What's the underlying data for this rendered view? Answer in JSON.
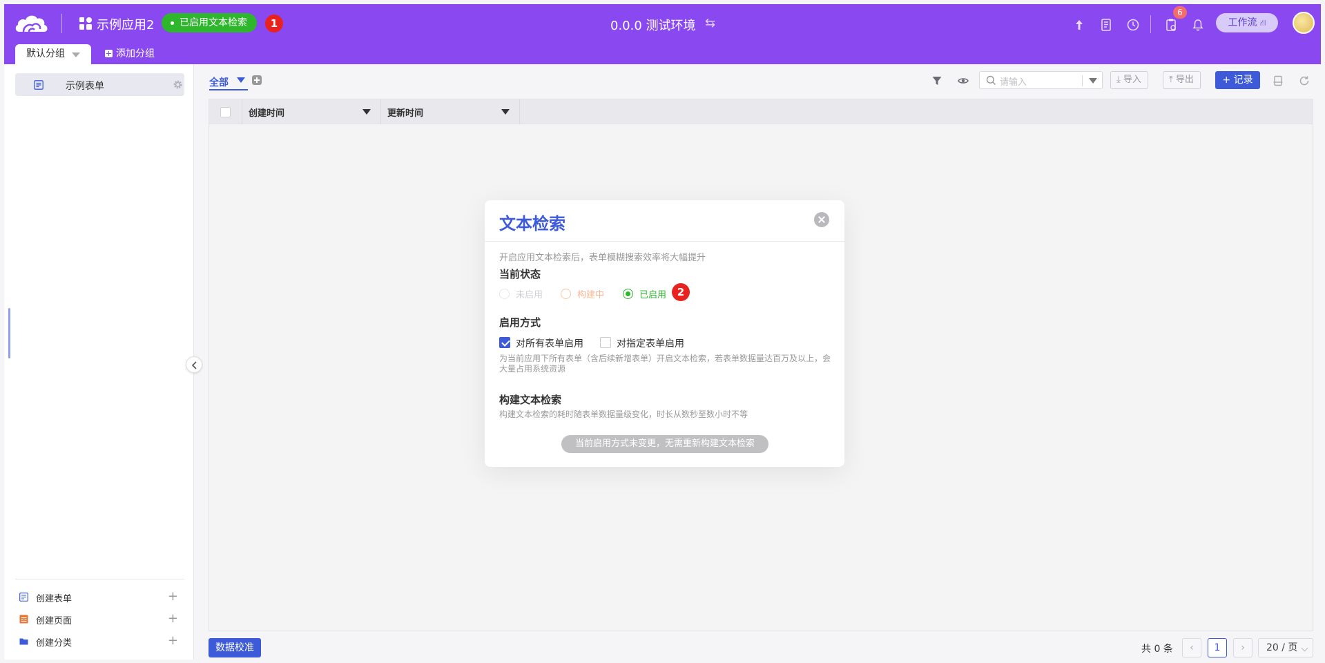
{
  "header": {
    "app_name": "示例应用2",
    "search_badge": "已启用文本检索",
    "marker_1": "1",
    "env_title": "0.0.0 测试环境",
    "notification_count": "6",
    "workflow_label": "工作流",
    "brand_color": "#8a48f0"
  },
  "tabs": {
    "active": "默认分组",
    "add": "添加分组"
  },
  "sidebar": {
    "items": [
      {
        "label": "示例表单"
      }
    ],
    "actions": [
      {
        "label": "创建表单",
        "icon": "form-icon",
        "color": "#3d5bd9"
      },
      {
        "label": "创建页面",
        "icon": "page-icon",
        "color": "#e8722c"
      },
      {
        "label": "创建分类",
        "icon": "folder-icon",
        "color": "#3d5bd9"
      }
    ]
  },
  "toolbar": {
    "view_tab": "全部",
    "search_placeholder": "请输入",
    "import": "导入",
    "export": "导出",
    "add_record": "+ 记录"
  },
  "table": {
    "columns": [
      "创建时间",
      "更新时间"
    ]
  },
  "footer": {
    "validate_button": "数据校准",
    "total": "共 0 条",
    "current_page": "1",
    "page_size": "20 / 页"
  },
  "modal": {
    "title": "文本检索",
    "intro": "开启应用文本检索后，表单模糊搜索效率将大幅提升",
    "status_heading": "当前状态",
    "status_options": [
      "未启用",
      "构建中",
      "已启用"
    ],
    "status_selected": "已启用",
    "marker_2": "2",
    "mode_heading": "启用方式",
    "mode_options": [
      {
        "label": "对所有表单启用",
        "checked": true
      },
      {
        "label": "对指定表单启用",
        "checked": false
      }
    ],
    "mode_desc": "为当前应用下所有表单（含后续新增表单）开启文本检索，若表单数据量达百万及以上，会大量占用系统资源",
    "build_heading": "构建文本检索",
    "build_desc": "构建文本检索的耗时随表单数据量级变化，时长从数秒至数小时不等",
    "rebuild_button": "当前启用方式未变更，无需重新构建文本检索"
  }
}
